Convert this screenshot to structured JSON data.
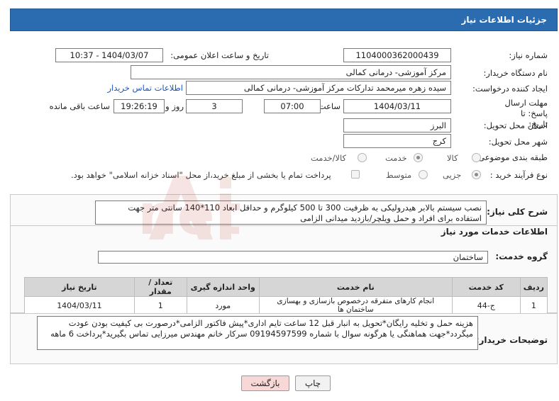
{
  "header": {
    "title": "جزئیات اطلاعات نیاز"
  },
  "fields": {
    "need_number_label": "شماره نیاز:",
    "need_number": "1104000362000439",
    "announce_label": "تاریخ و ساعت اعلان عمومی:",
    "announce_value": "1404/03/07 - 10:37",
    "buyer_org_label": "نام دستگاه خریدار:",
    "buyer_org": "مرکز آموزشی- درمانی کمالی",
    "creator_label": "ایجاد کننده درخواست:",
    "creator": "سیده زهره میرمحمد تدارکات مرکز آموزشی- درمانی کمالی",
    "buyer_contact_link": "اطلاعات تماس خریدار",
    "deadline_label": "مهلت ارسال پاسخ: تا تاریخ:",
    "deadline_date": "1404/03/11",
    "time_label": "ساعت",
    "deadline_time": "07:00",
    "days_value": "3",
    "days_label": "روز و",
    "remaining_time": "19:26:19",
    "remaining_label": "ساعت باقی مانده",
    "province_label": "استان محل تحویل:",
    "province": "البرز",
    "city_label": "شهر محل تحویل:",
    "city": "کرج",
    "category_label": "طبقه بندی موضوعی:",
    "category_options": [
      "کالا",
      "خدمت",
      "کالا/خدمت"
    ],
    "category_selected": "خدمت",
    "process_label": "نوع فرآیند خرید :",
    "process_options": [
      "جزیی",
      "متوسط"
    ],
    "process_selected": "جزیی",
    "payment_note": "پرداخت تمام یا بخشی از مبلغ خرید،از محل \"اسناد خزانه اسلامی\" خواهد بود."
  },
  "description": {
    "label": "شرح کلی نیاز:",
    "text": "نصب سیستم بالابر هیدرولیکی به ظرفیت 300 تا 500 کیلوگرم و حداقل ابعاد 110*140 سانتی متر جهت استفاده برای افراد و حمل ویلچر/بازدید میدانی الزامی"
  },
  "services": {
    "title": "اطلاعات خدمات مورد نیاز",
    "group_label": "گروه خدمت:",
    "group_value": "ساختمان",
    "columns": [
      "ردیف",
      "کد خدمت",
      "نام خدمت",
      "واحد اندازه گیری",
      "تعداد / مقدار",
      "تاریخ نیاز"
    ],
    "rows": [
      [
        "1",
        "ج-44",
        "انجام کارهای متفرقه درخصوص بازسازی و بهسازی ساختمان ها",
        "مورد",
        "1",
        "1404/03/11"
      ]
    ]
  },
  "buyer_notes": {
    "label": "توضیحات خریدار:",
    "text": "هزینه حمل و تخلیه رایگان*تحویل به انبار قبل 12 ساعت تایم اداری*پیش فاکتور الزامی*درصورت بی کیفیت بودن عودت میگردد*جهت هماهنگی یا هرگونه سوال با شماره 09194597599 سرکار خانم مهندس میرزایی تماس بگیرید*پرداخت 6 ماهه"
  },
  "buttons": {
    "print": "چاپ",
    "back": "بازگشت"
  },
  "colors": {
    "header": "#2b6cb0",
    "link": "#1a56c4",
    "back_button": "#f8d7d7",
    "print_button": "#f2f2f2"
  }
}
